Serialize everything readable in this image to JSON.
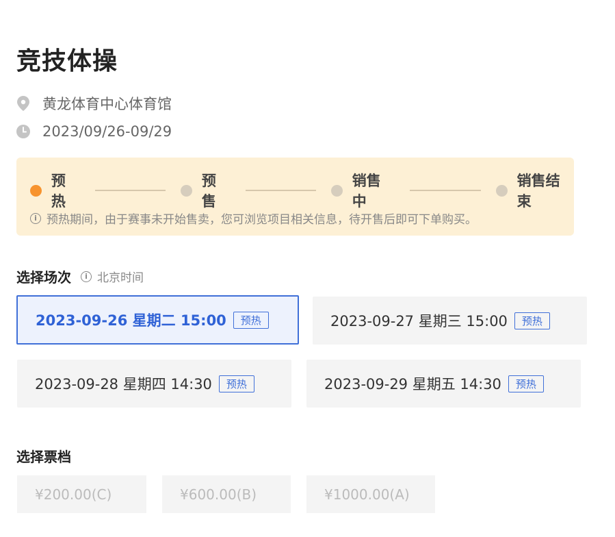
{
  "event": {
    "title": "竞技体操",
    "venue": "黄龙体育中心体育馆",
    "dates": "2023/09/26-09/29"
  },
  "status": {
    "steps": [
      {
        "label": "预热",
        "active": true
      },
      {
        "label": "预售",
        "active": false
      },
      {
        "label": "销售中",
        "active": false
      },
      {
        "label": "销售结束",
        "active": false
      }
    ],
    "hint": "预热期间，由于赛事未开始售卖，您可浏览项目相关信息，待开售后即可下单购买。",
    "active_color": "#f7932e"
  },
  "sessions_section": {
    "title": "选择场次",
    "timezone": "北京时间",
    "sessions": [
      {
        "label": "2023-09-26 星期二 15:00",
        "tag": "预热",
        "selected": true
      },
      {
        "label": "2023-09-27 星期三 15:00",
        "tag": "预热",
        "selected": false
      },
      {
        "label": "2023-09-28 星期四 14:30",
        "tag": "预热",
        "selected": false
      },
      {
        "label": "2023-09-29 星期五 14:30",
        "tag": "预热",
        "selected": false
      }
    ]
  },
  "tickets_section": {
    "title": "选择票档",
    "prices": [
      "¥200.00(C)",
      "¥600.00(B)",
      "¥1000.00(A)"
    ]
  },
  "icons": {
    "venue": "location-pin-icon",
    "time": "clock-icon",
    "hint": "info-icon"
  },
  "colors": {
    "accent_blue": "#3f6fd8",
    "status_bg": "#fdf0d5"
  }
}
